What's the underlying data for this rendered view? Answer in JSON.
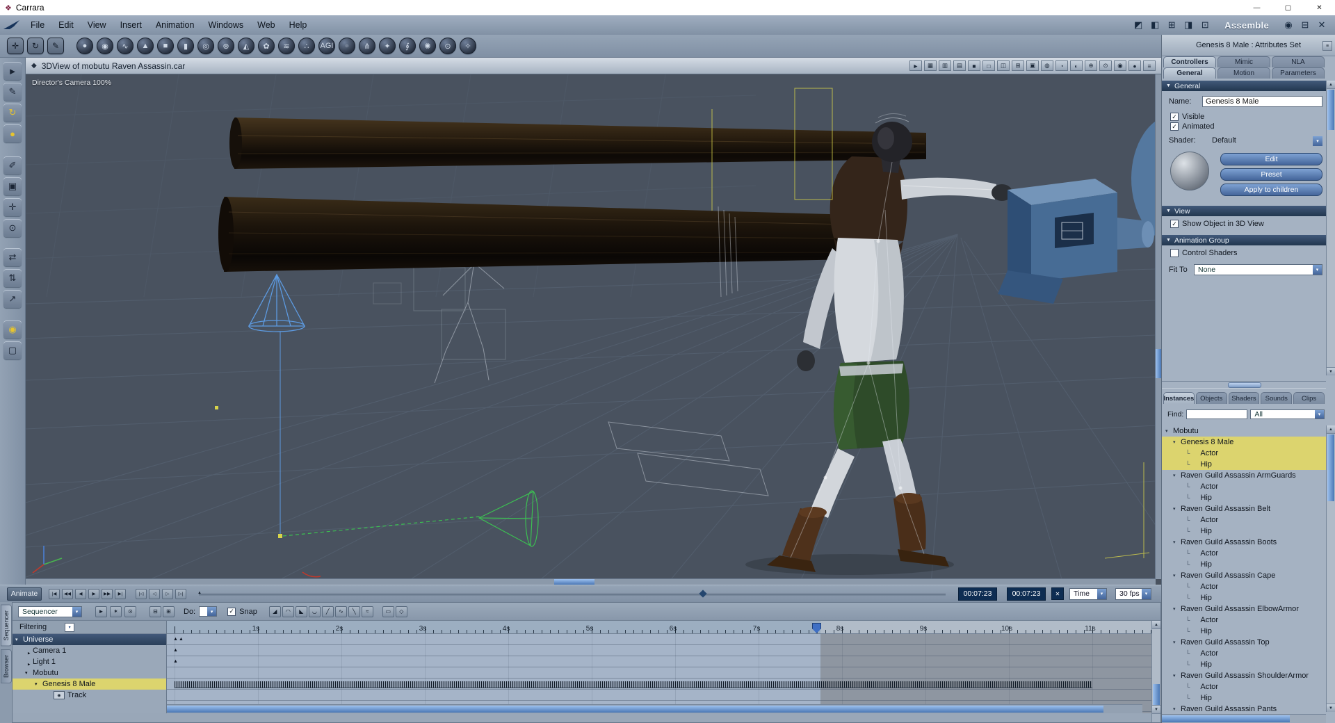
{
  "window": {
    "title": "Carrara"
  },
  "titlebar": {
    "app_icon": "❖",
    "minimize_icon": "—",
    "maximize_icon": "▢",
    "close_icon": "✕"
  },
  "menubar": {
    "items": [
      "File",
      "Edit",
      "View",
      "Insert",
      "Animation",
      "Windows",
      "Web",
      "Help"
    ],
    "right_icons": [
      {
        "name": "texture-room-icon",
        "glyph": "◩"
      },
      {
        "name": "model-room-icon",
        "glyph": "◧"
      },
      {
        "name": "storyboard-room-icon",
        "glyph": "⊞"
      },
      {
        "name": "render-room-icon",
        "glyph": "◨"
      },
      {
        "name": "assemble-room-icon",
        "glyph": "⊡"
      }
    ],
    "mode_label": "Assemble",
    "window_icons": [
      {
        "name": "eye-icon",
        "glyph": "◉"
      },
      {
        "name": "collapse-panel-icon",
        "glyph": "⊟"
      },
      {
        "name": "close-view-icon",
        "glyph": "✕"
      }
    ]
  },
  "toolbar": {
    "group1": [
      {
        "name": "wrench-tool-icon",
        "glyph": "✛"
      },
      {
        "name": "rotate-scene-tool-icon",
        "glyph": "↻"
      },
      {
        "name": "brush-tool-icon",
        "glyph": "✎"
      }
    ],
    "primitives": [
      {
        "name": "sphere-primitive-icon",
        "glyph": "●"
      },
      {
        "name": "vertex-object-icon",
        "glyph": "◉"
      },
      {
        "name": "spline-object-icon",
        "glyph": "∿"
      },
      {
        "name": "cone-primitive-icon",
        "glyph": "▲"
      },
      {
        "name": "cube-primitive-icon",
        "glyph": "■"
      },
      {
        "name": "cylinder-primitive-icon",
        "glyph": "▮"
      },
      {
        "name": "torus-primitive-icon",
        "glyph": "◎"
      },
      {
        "name": "metaball-icon",
        "glyph": "⊛"
      },
      {
        "name": "terrain-icon",
        "glyph": "◭"
      },
      {
        "name": "plant-icon",
        "glyph": "✿"
      },
      {
        "name": "hair-icon",
        "glyph": "≋"
      },
      {
        "name": "particle-icon",
        "glyph": "∴"
      },
      {
        "name": "font-text-icon",
        "glyph": "AGI"
      },
      {
        "name": "morph-icon",
        "glyph": "☺"
      },
      {
        "name": "bones-icon",
        "glyph": "⋔"
      },
      {
        "name": "physics-icon",
        "glyph": "✦"
      },
      {
        "name": "spring-icon",
        "glyph": "∮"
      },
      {
        "name": "light-icon",
        "glyph": "✺"
      },
      {
        "name": "camera-icon",
        "glyph": "⊙"
      },
      {
        "name": "wand-icon",
        "glyph": "✧"
      }
    ]
  },
  "left_toolbar": [
    {
      "name": "select-tool-icon",
      "glyph": "►"
    },
    {
      "name": "pen-tool-icon",
      "glyph": "✎"
    },
    {
      "name": "rotate-tool-icon",
      "glyph": "↻",
      "accent": true
    },
    {
      "name": "sphere-paint-tool-icon",
      "glyph": "●",
      "accent": true
    },
    {
      "name": "eyedropper-tool-icon",
      "glyph": "✐"
    },
    {
      "name": "frame-tool-icon",
      "glyph": "▣"
    },
    {
      "name": "pan-tool-icon",
      "glyph": "✛"
    },
    {
      "name": "zoom-tool-icon",
      "glyph": "⊙"
    },
    {
      "name": "move-x-tool-icon",
      "glyph": "⇄"
    },
    {
      "name": "move-y-tool-icon",
      "glyph": "⇅"
    },
    {
      "name": "move-z-tool-icon",
      "glyph": "↗"
    },
    {
      "name": "hotpoint-tool-icon",
      "glyph": "◉",
      "accent": true
    },
    {
      "name": "bbox-tool-icon",
      "glyph": "▢"
    }
  ],
  "viewport": {
    "title": "3DView of mobutu Raven Assassin.car",
    "title_icon": "◆",
    "camera_label": "Director's Camera 100%",
    "header_icons": [
      {
        "name": "select-display-icon",
        "glyph": "►"
      },
      {
        "name": "grid-display-icon",
        "glyph": "▦"
      },
      {
        "name": "stats-display-icon",
        "glyph": "▥"
      },
      {
        "name": "film-display-icon",
        "glyph": "▤"
      },
      {
        "name": "solo-view-icon",
        "glyph": "■"
      },
      {
        "name": "single-view-icon",
        "glyph": "□"
      },
      {
        "name": "dual-view-icon",
        "glyph": "◫"
      },
      {
        "name": "quad-view-icon",
        "glyph": "⊞"
      },
      {
        "name": "layout-grid-icon",
        "glyph": "▣"
      },
      {
        "name": "wire-sphere-icon",
        "glyph": "◍"
      },
      {
        "name": "shaded-sphere-icon",
        "glyph": "◔"
      },
      {
        "name": "textured-sphere-icon",
        "glyph": "◐"
      },
      {
        "name": "anchor-icon",
        "glyph": "⊕"
      },
      {
        "name": "target-icon",
        "glyph": "⊙"
      },
      {
        "name": "rotate-view-icon",
        "glyph": "◉"
      },
      {
        "name": "light-toggle-icon",
        "glyph": "●"
      },
      {
        "name": "view-options-icon",
        "glyph": "≡"
      }
    ]
  },
  "attributes_panel": {
    "header": "Genesis 8 Male : Attributes Set",
    "tabs": [
      {
        "label": "Controllers",
        "active": true
      },
      {
        "label": "Mimic"
      },
      {
        "label": "NLA"
      }
    ],
    "subtabs": [
      {
        "label": "General",
        "active": true
      },
      {
        "label": "Motion"
      },
      {
        "label": "Parameters"
      }
    ],
    "general": {
      "section_label": "General",
      "name_label": "Name:",
      "name_value": "Genesis 8 Male",
      "visible_label": "Visible",
      "visible_checked": true,
      "animated_label": "Animated",
      "animated_checked": true,
      "shader_label": "Shader:",
      "shader_value": "Default",
      "edit_button": "Edit",
      "preset_button": "Preset",
      "apply_button": "Apply to children"
    },
    "view_section": {
      "section_label": "View",
      "show_object_label": "Show Object in 3D View",
      "show_object_checked": true
    },
    "animation_group": {
      "section_label": "Animation Group",
      "control_shaders_label": "Control Shaders",
      "control_shaders_checked": false,
      "fit_to_label": "Fit To",
      "fit_to_value": "None"
    }
  },
  "browser_panel": {
    "tabs": [
      {
        "label": "Instances",
        "active": true
      },
      {
        "label": "Objects"
      },
      {
        "label": "Shaders"
      },
      {
        "label": "Sounds"
      },
      {
        "label": "Clips"
      }
    ],
    "find_label": "Find:",
    "find_value": "",
    "scope_value": "All",
    "tree": [
      {
        "label": "Mobutu",
        "level": 0,
        "flipper": true
      },
      {
        "label": "Genesis 8 Male",
        "level": 1,
        "flipper": true,
        "selected": true
      },
      {
        "label": "Actor",
        "level": 2,
        "selected": true
      },
      {
        "label": "Hip",
        "level": 2,
        "selected": true
      },
      {
        "label": "Raven Guild Assassin ArmGuards",
        "level": 1,
        "flipper": true
      },
      {
        "label": "Actor",
        "level": 2
      },
      {
        "label": "Hip",
        "level": 2
      },
      {
        "label": "Raven Guild Assassin Belt",
        "level": 1,
        "flipper": true
      },
      {
        "label": "Actor",
        "level": 2
      },
      {
        "label": "Hip",
        "level": 2
      },
      {
        "label": "Raven Guild Assassin Boots",
        "level": 1,
        "flipper": true
      },
      {
        "label": "Actor",
        "level": 2
      },
      {
        "label": "Hip",
        "level": 2
      },
      {
        "label": "Raven Guild Assassin Cape",
        "level": 1,
        "flipper": true
      },
      {
        "label": "Actor",
        "level": 2
      },
      {
        "label": "Hip",
        "level": 2
      },
      {
        "label": "Raven Guild Assassin ElbowArmor",
        "level": 1,
        "flipper": true
      },
      {
        "label": "Actor",
        "level": 2
      },
      {
        "label": "Hip",
        "level": 2
      },
      {
        "label": "Raven Guild Assassin Top",
        "level": 1,
        "flipper": true
      },
      {
        "label": "Actor",
        "level": 2
      },
      {
        "label": "Hip",
        "level": 2
      },
      {
        "label": "Raven Guild Assassin ShoulderArmor",
        "level": 1,
        "flipper": true
      },
      {
        "label": "Actor",
        "level": 2
      },
      {
        "label": "Hip",
        "level": 2
      },
      {
        "label": "Raven Guild Assassin Pants",
        "level": 1,
        "flipper": true
      }
    ]
  },
  "transport": {
    "animate_label": "Animate",
    "play_buttons": [
      {
        "name": "go-start-button",
        "glyph": "|◀"
      },
      {
        "name": "prev-key-button",
        "glyph": "◀◀"
      },
      {
        "name": "play-reverse-button",
        "glyph": "◀"
      },
      {
        "name": "play-button",
        "glyph": "▶"
      },
      {
        "name": "next-key-button",
        "glyph": "▶▶"
      },
      {
        "name": "go-end-button",
        "glyph": "▶|"
      }
    ],
    "loop_buttons": [
      {
        "name": "range-start-button",
        "glyph": "|◁"
      },
      {
        "name": "step-back-button",
        "glyph": "◁"
      },
      {
        "name": "step-forward-button",
        "glyph": "▷"
      },
      {
        "name": "range-end-button",
        "glyph": "▷|"
      }
    ],
    "current_time": "00:07:23",
    "end_time": "00:07:23",
    "delete_icon": "✕",
    "time_mode_value": "Time",
    "fps_value": "30 fps"
  },
  "sequencer": {
    "left_tabs": [
      {
        "label": "Sequencer",
        "active": true
      },
      {
        "label": "Browser"
      }
    ],
    "panel_select_value": "Sequencer",
    "toolbar_icons": [
      {
        "name": "select-mode-icon",
        "glyph": "►"
      },
      {
        "name": "add-key-icon",
        "glyph": "✶"
      },
      {
        "name": "zoom-mode-icon",
        "glyph": "⊙"
      }
    ],
    "range_icons": [
      {
        "name": "shrink-range-icon",
        "glyph": "⊟"
      },
      {
        "name": "expand-range-icon",
        "glyph": "⊞"
      }
    ],
    "do_label": "Do:",
    "snap_label": "Snap",
    "snap_checked": true,
    "tangent_icons": [
      {
        "name": "tangent-sharp-in-icon",
        "glyph": "◢"
      },
      {
        "name": "tangent-smooth-in-icon",
        "glyph": "◠"
      },
      {
        "name": "tangent-sharp-out-icon",
        "glyph": "◣"
      },
      {
        "name": "tangent-smooth-out-icon",
        "glyph": "◡"
      },
      {
        "name": "tangent-linear-icon",
        "glyph": "╱"
      },
      {
        "name": "tangent-curve-icon",
        "glyph": "∿"
      },
      {
        "name": "tangent-step-icon",
        "glyph": "╲"
      },
      {
        "name": "tangent-auto-icon",
        "glyph": "≈"
      }
    ],
    "extra_icons": [
      {
        "name": "marker-icon",
        "glyph": "▭"
      },
      {
        "name": "key-diamond-icon",
        "glyph": "◇"
      }
    ],
    "filtering_label": "Filtering",
    "tree": [
      {
        "label": "Universe",
        "level": 0,
        "header": true,
        "flipper": true
      },
      {
        "label": "Camera 1",
        "level": 1,
        "flipper": true,
        "collapsed": true
      },
      {
        "label": "Light 1",
        "level": 1,
        "flipper": true,
        "collapsed": true
      },
      {
        "label": "Mobutu",
        "level": 1,
        "flipper": true
      },
      {
        "label": "Genesis 8 Male",
        "level": 2,
        "flipper": true,
        "selected": true
      },
      {
        "label": "Track",
        "level": 3,
        "eye": true
      }
    ],
    "ruler_labels": [
      "1s",
      "2s",
      "3s",
      "4s",
      "5s",
      "6s",
      "7s",
      "8s",
      "9s",
      "10s",
      "11s"
    ]
  }
}
